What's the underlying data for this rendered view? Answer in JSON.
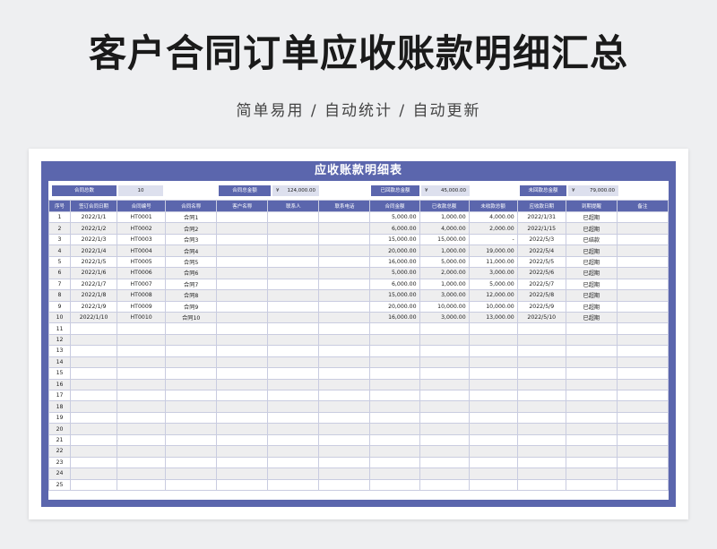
{
  "page": {
    "title": "客户合同订单应收账款明细汇总",
    "subtitle": "简单易用 / 自动统计 / 自动更新"
  },
  "sheet": {
    "title": "应收账款明细表",
    "summary": {
      "contract_count_label": "合同总数",
      "contract_count_value": "10",
      "contract_total_label": "合同总金额",
      "contract_total_currency": "¥",
      "contract_total_value": "124,000.00",
      "received_total_label": "已回款总金额",
      "received_total_currency": "¥",
      "received_total_value": "45,000.00",
      "unreceived_total_label": "未回款总金额",
      "unreceived_total_currency": "¥",
      "unreceived_total_value": "79,000.00"
    },
    "columns": [
      "序号",
      "签订合同日期",
      "合同编号",
      "合同名称",
      "客户名称",
      "联系人",
      "联系电话",
      "合同金额",
      "已收款总额",
      "未收款总额",
      "应收款日期",
      "到期提醒",
      "备注"
    ],
    "rows": [
      [
        "1",
        "2022/1/1",
        "HT0001",
        "合同1",
        "",
        "",
        "",
        "5,000.00",
        "1,000.00",
        "4,000.00",
        "2022/1/31",
        "已超期",
        ""
      ],
      [
        "2",
        "2022/1/2",
        "HT0002",
        "合同2",
        "",
        "",
        "",
        "6,000.00",
        "4,000.00",
        "2,000.00",
        "2022/1/15",
        "已超期",
        ""
      ],
      [
        "3",
        "2022/1/3",
        "HT0003",
        "合同3",
        "",
        "",
        "",
        "15,000.00",
        "15,000.00",
        "-",
        "2022/5/3",
        "已结款",
        ""
      ],
      [
        "4",
        "2022/1/4",
        "HT0004",
        "合同4",
        "",
        "",
        "",
        "20,000.00",
        "1,000.00",
        "19,000.00",
        "2022/5/4",
        "已超期",
        ""
      ],
      [
        "5",
        "2022/1/5",
        "HT0005",
        "合同5",
        "",
        "",
        "",
        "16,000.00",
        "5,000.00",
        "11,000.00",
        "2022/5/5",
        "已超期",
        ""
      ],
      [
        "6",
        "2022/1/6",
        "HT0006",
        "合同6",
        "",
        "",
        "",
        "5,000.00",
        "2,000.00",
        "3,000.00",
        "2022/5/6",
        "已超期",
        ""
      ],
      [
        "7",
        "2022/1/7",
        "HT0007",
        "合同7",
        "",
        "",
        "",
        "6,000.00",
        "1,000.00",
        "5,000.00",
        "2022/5/7",
        "已超期",
        ""
      ],
      [
        "8",
        "2022/1/8",
        "HT0008",
        "合同8",
        "",
        "",
        "",
        "15,000.00",
        "3,000.00",
        "12,000.00",
        "2022/5/8",
        "已超期",
        ""
      ],
      [
        "9",
        "2022/1/9",
        "HT0009",
        "合同9",
        "",
        "",
        "",
        "20,000.00",
        "10,000.00",
        "10,000.00",
        "2022/5/9",
        "已超期",
        ""
      ],
      [
        "10",
        "2022/1/10",
        "HT0010",
        "合同10",
        "",
        "",
        "",
        "16,000.00",
        "3,000.00",
        "13,000.00",
        "2022/5/10",
        "已超期",
        ""
      ],
      [
        "11",
        "",
        "",
        "",
        "",
        "",
        "",
        "",
        "",
        "",
        "",
        "",
        ""
      ],
      [
        "12",
        "",
        "",
        "",
        "",
        "",
        "",
        "",
        "",
        "",
        "",
        "",
        ""
      ],
      [
        "13",
        "",
        "",
        "",
        "",
        "",
        "",
        "",
        "",
        "",
        "",
        "",
        ""
      ],
      [
        "14",
        "",
        "",
        "",
        "",
        "",
        "",
        "",
        "",
        "",
        "",
        "",
        ""
      ],
      [
        "15",
        "",
        "",
        "",
        "",
        "",
        "",
        "",
        "",
        "",
        "",
        "",
        ""
      ],
      [
        "16",
        "",
        "",
        "",
        "",
        "",
        "",
        "",
        "",
        "",
        "",
        "",
        ""
      ],
      [
        "17",
        "",
        "",
        "",
        "",
        "",
        "",
        "",
        "",
        "",
        "",
        "",
        ""
      ],
      [
        "18",
        "",
        "",
        "",
        "",
        "",
        "",
        "",
        "",
        "",
        "",
        "",
        ""
      ],
      [
        "19",
        "",
        "",
        "",
        "",
        "",
        "",
        "",
        "",
        "",
        "",
        "",
        ""
      ],
      [
        "20",
        "",
        "",
        "",
        "",
        "",
        "",
        "",
        "",
        "",
        "",
        "",
        ""
      ],
      [
        "21",
        "",
        "",
        "",
        "",
        "",
        "",
        "",
        "",
        "",
        "",
        "",
        ""
      ],
      [
        "22",
        "",
        "",
        "",
        "",
        "",
        "",
        "",
        "",
        "",
        "",
        "",
        ""
      ],
      [
        "23",
        "",
        "",
        "",
        "",
        "",
        "",
        "",
        "",
        "",
        "",
        "",
        ""
      ],
      [
        "24",
        "",
        "",
        "",
        "",
        "",
        "",
        "",
        "",
        "",
        "",
        "",
        ""
      ],
      [
        "25",
        "",
        "",
        "",
        "",
        "",
        "",
        "",
        "",
        "",
        "",
        "",
        ""
      ]
    ]
  },
  "colors": {
    "header_bg": "#5b66ad",
    "page_bg": "#eeeff1",
    "summary_value_bg": "#dde0ee"
  }
}
